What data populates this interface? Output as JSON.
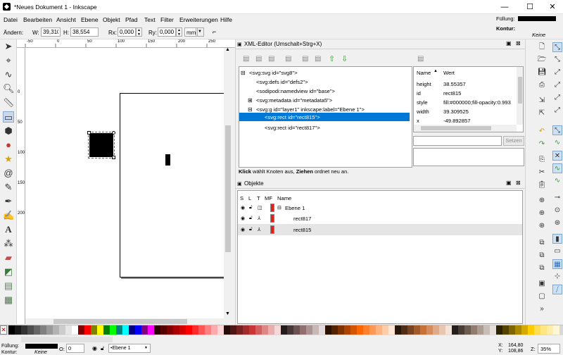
{
  "window": {
    "title": "*Neues Dokument 1 - Inkscape",
    "min": "—",
    "max": "☐",
    "close": "✕"
  },
  "menu": [
    "Datei",
    "Bearbeiten",
    "Ansicht",
    "Ebene",
    "Objekt",
    "Pfad",
    "Text",
    "Filter",
    "Erweiterungen",
    "Hilfe"
  ],
  "style_indicator": {
    "fill_label": "Füllung:",
    "stroke_label": "Kontur:",
    "stroke_value": "Keine",
    "fill_color": "#000000"
  },
  "controls": {
    "change_label": "Ändern:",
    "w_label": "W:",
    "w_value": "39,310",
    "h_label": "H:",
    "h_value": "38,554",
    "rx_label": "Rx:",
    "rx_value": "0,000",
    "ry_label": "Ry:",
    "ry_value": "0,000",
    "unit": "mm"
  },
  "ruler_labels": {
    "h": [
      "-50",
      "0",
      "50",
      "100",
      "150",
      "200",
      "250"
    ],
    "v": [
      "0",
      "50",
      "100",
      "150",
      "200"
    ]
  },
  "xml_editor": {
    "title": "XML-Editor (Umschalt+Strg+X)",
    "nodes": [
      {
        "text": "<svg:svg id=\"svg8\">",
        "expander": "⊟"
      },
      {
        "text": "<svg:defs id=\"defs2\">",
        "expander": ""
      },
      {
        "text": "<sodipodi:namedview id=\"base\">",
        "expander": ""
      },
      {
        "text": "<svg:metadata id=\"metadata5\">",
        "expander": "⊞"
      },
      {
        "text": "<svg:g id=\"layer1\" inkscape:label=\"Ebene 1\">",
        "expander": "⊟"
      },
      {
        "text": "<svg:rect id=\"rect815\">",
        "expander": ""
      },
      {
        "text": "<svg:rect id=\"rect817\">",
        "expander": ""
      }
    ],
    "attr_headers": {
      "name": "Name",
      "value": "Wert"
    },
    "attributes": [
      {
        "name": "height",
        "value": "38.55357"
      },
      {
        "name": "id",
        "value": "rect815"
      },
      {
        "name": "style",
        "value": "fill:#000000;fill-opacity:0.993"
      },
      {
        "name": "width",
        "value": "39.309525"
      },
      {
        "name": "x",
        "value": "-49.892857"
      }
    ],
    "set_button": "Setzen",
    "hint_bold1": "Klick",
    "hint_text1": " wählt Knoten aus, ",
    "hint_bold2": "Ziehen",
    "hint_text2": " ordnet neu an."
  },
  "objects": {
    "title": "Objekte",
    "headers": [
      "S",
      "L",
      "T",
      "MF",
      "Name"
    ],
    "rows": [
      {
        "name": "Ebene 1"
      },
      {
        "name": "rect817"
      },
      {
        "name": "rect815"
      }
    ]
  },
  "palette_colors": [
    "#000000",
    "#1a1a1a",
    "#333333",
    "#4d4d4d",
    "#666666",
    "#808080",
    "#999999",
    "#b3b3b3",
    "#cccccc",
    "#e6e6e6",
    "#ffffff",
    "#800000",
    "#ff0000",
    "#808000",
    "#ffff00",
    "#008000",
    "#00ff00",
    "#008080",
    "#00ffff",
    "#000080",
    "#0000ff",
    "#800080",
    "#ff00ff",
    "#2b0000",
    "#550000",
    "#800000",
    "#aa0000",
    "#d40000",
    "#ff0000",
    "#ff2a2a",
    "#ff5555",
    "#ff8080",
    "#ffaaaa",
    "#ffd5d5",
    "#280b0b",
    "#501616",
    "#782121",
    "#a02c2c",
    "#c83737",
    "#d35f5f",
    "#de8787",
    "#e9afaf",
    "#f4d7d7",
    "#241c1c",
    "#483737",
    "#6c5353",
    "#916f6f",
    "#ac9393",
    "#c8b7b7",
    "#e3dbdb",
    "#2b1100",
    "#552200",
    "#803300",
    "#aa4400",
    "#d45500",
    "#ff6600",
    "#ff7f2a",
    "#ff9955",
    "#ffb380",
    "#ffccaa",
    "#ffe6d5",
    "#28170b",
    "#502d16",
    "#784421",
    "#a05a2c",
    "#c87137",
    "#d38d5f",
    "#deaa87",
    "#e9c6af",
    "#f4e3d7",
    "#241f1c",
    "#483e37",
    "#6c5d53",
    "#917c6f",
    "#ac9d93",
    "#c8beb7",
    "#e3dedb",
    "#2b2200",
    "#554400",
    "#806600",
    "#aa8800",
    "#d4aa00",
    "#ffcc00",
    "#ffdd55",
    "#ffe680",
    "#ffeeaa",
    "#fff6d5"
  ],
  "status": {
    "fill_label": "Füllung:",
    "stroke_label": "Kontur:",
    "stroke_value": "Keine",
    "opacity_label": "O:",
    "opacity_value": "0",
    "layer": "•Ebene 1",
    "x_label": "X:",
    "x_value": "164,80",
    "y_label": "Y:",
    "y_value": "108,86",
    "z_label": "Z:",
    "z_value": "35%"
  }
}
